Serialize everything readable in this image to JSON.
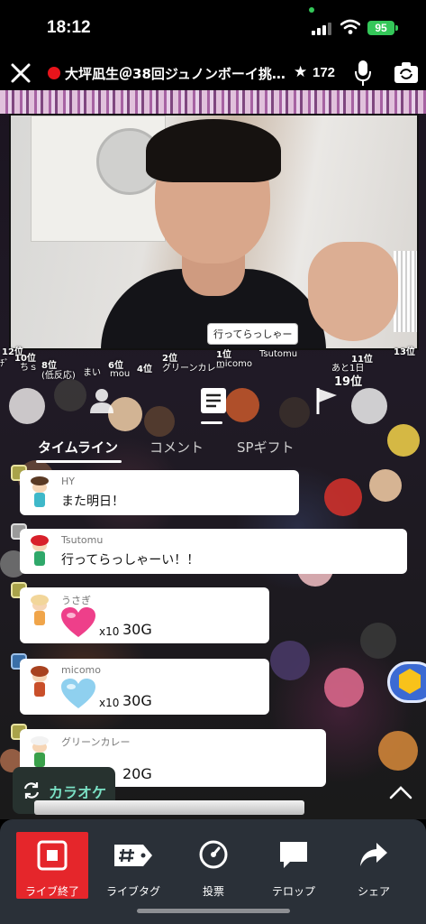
{
  "status_bar": {
    "time": "18:12",
    "battery": "95"
  },
  "header": {
    "stream_title": "大坪凪生＠38回ジュノンボーイ挑戦…",
    "star_count": "172"
  },
  "stream": {
    "speech_bubble": "行ってらっしゃー",
    "rank_labels": [
      "12位",
      "10位",
      "8位",
      "6位",
      "4位",
      "2位",
      "1位",
      "11位",
      "13位"
    ],
    "rank_user_labels": [
      "ﾁﾞ",
      "ちｓ",
      "(低反応)",
      "まい",
      "mou",
      "グリーンカレー",
      "micomo",
      "Tsutomu"
    ],
    "rank_countdown": "あと1日",
    "rank_position": "19位"
  },
  "tabs": [
    {
      "label": "タイムライン",
      "active": true
    },
    {
      "label": "コメント",
      "active": false
    },
    {
      "label": "SPギフト",
      "active": false
    }
  ],
  "comments": [
    {
      "type": "text",
      "name": "HY",
      "text": "また明日！",
      "badge": "level"
    },
    {
      "type": "text",
      "name": "Tsutomu",
      "text": "行ってらっしゃーい！！",
      "badge": "gray"
    },
    {
      "type": "gift",
      "name": "うさぎ",
      "gift": "pink-heart",
      "multiplier": "x10",
      "value": "30G",
      "badge": "level"
    },
    {
      "type": "gift",
      "name": "micomo",
      "gift": "blue-heart",
      "multiplier": "x10",
      "value": "30G",
      "badge": "blue"
    },
    {
      "type": "gift",
      "name": "グリーンカレー",
      "gift": "hidden",
      "multiplier": "",
      "value": "20G",
      "badge": "level"
    }
  ],
  "karaoke": {
    "label": "カラオケ"
  },
  "toolbar": {
    "end_live": "ライブ終了",
    "live_tag": "ライブタグ",
    "vote": "投票",
    "telop": "テロップ",
    "share": "シェア"
  },
  "colors": {
    "end_button": "#e5262b",
    "toolbar_bg": "#2a3038",
    "karaoke_text": "#7ae0c4",
    "rec_dot": "#e8141b",
    "battery": "#34c759"
  },
  "icons": [
    "close-icon",
    "record-dot-icon",
    "star-icon",
    "mic-icon",
    "camera-switch-icon",
    "user-icon",
    "list-icon",
    "flag-icon",
    "karaoke-refresh-icon",
    "chevron-up-icon",
    "stop-icon",
    "hashtag-tag-icon",
    "vote-icon",
    "chat-bubble-icon",
    "share-arrow-icon",
    "gift-box-icon"
  ]
}
